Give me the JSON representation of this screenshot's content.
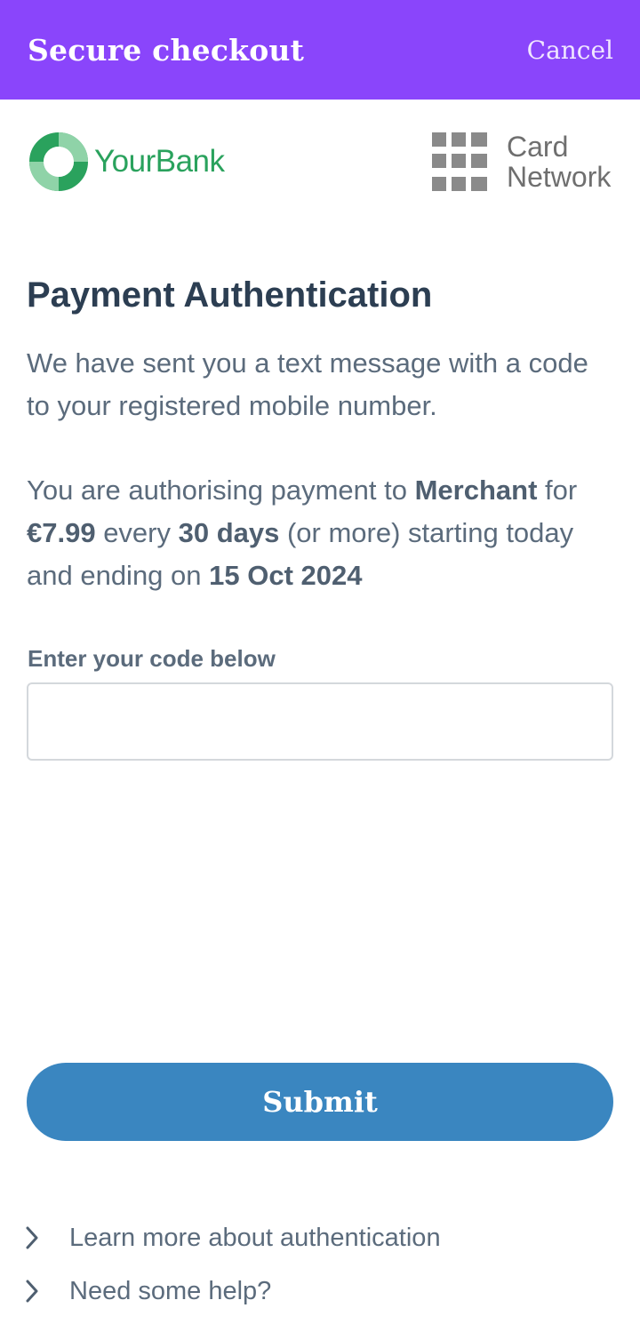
{
  "header": {
    "title": "Secure checkout",
    "cancel_label": "Cancel",
    "background": "#8a45fb"
  },
  "logos": {
    "bank_name": "YourBank",
    "bank_icon": "bank-ring-icon",
    "bank_color": "#2aa25d",
    "network_line1": "Card",
    "network_line2": "Network",
    "network_icon": "grid-icon"
  },
  "content": {
    "title": "Payment Authentication",
    "message": "We have sent you a text message with a code to your registered mobile number.",
    "auth_prefix": "You are authorising payment to ",
    "merchant": "Merchant",
    "for_text": " for ",
    "amount": "€7.99",
    "every_text": " every ",
    "period": "30 days",
    "starting_text": " (or more) starting today and ending on ",
    "end_date": "15 Oct 2024"
  },
  "form": {
    "code_label": "Enter your code below",
    "code_value": "",
    "submit_label": "Submit",
    "submit_color": "#3a86c0"
  },
  "links": [
    {
      "label": "Learn more about authentication",
      "icon": "chevron-right-icon"
    },
    {
      "label": "Need some help?",
      "icon": "chevron-right-icon"
    }
  ]
}
